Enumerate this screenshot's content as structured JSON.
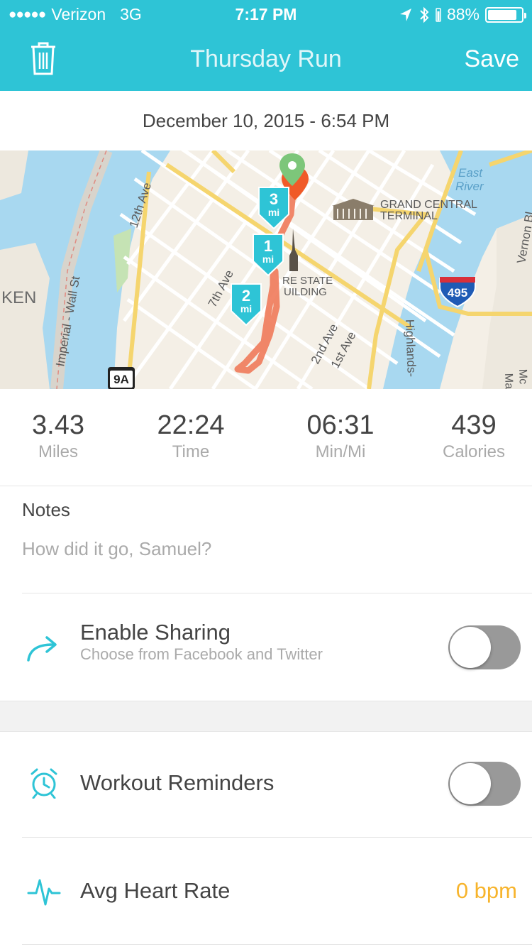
{
  "status_bar": {
    "signal_dots": "●●●●●",
    "carrier": "Verizon",
    "network": "3G",
    "time": "7:17 PM",
    "battery_text": "88%",
    "battery_level": 0.88
  },
  "nav": {
    "title": "Thursday Run",
    "save_label": "Save",
    "delete_icon": "trash-icon"
  },
  "run_datetime": "December 10, 2015 - 6:54 PM",
  "map": {
    "labels": {
      "east_river": "East\nRiver",
      "grand_central": "GRAND CENTRAL\nTERMINAL",
      "empire_state": "RE STATE\nUILDING",
      "twelfth_ave": "12th Ave",
      "seventh_ave": "7th Ave",
      "second_ave": "2nd Ave",
      "first_ave": "1st Ave",
      "imperial_wall": "Imperial - Wall St",
      "highlands": "Highlands-",
      "vernon": "Vernon Bl",
      "ken": "KEN",
      "mc": "Mc",
      "ma": "Ma"
    },
    "shields": {
      "interstate": "495",
      "route": "9A"
    },
    "mile_markers": [
      {
        "num": "3",
        "unit": "mi"
      },
      {
        "num": "1",
        "unit": "mi"
      },
      {
        "num": "2",
        "unit": "mi"
      }
    ],
    "colors": {
      "route": "#f07a5a",
      "marker": "#2ec4d6",
      "start_pin": "#7dc67a",
      "end_pin": "#f05a28",
      "water": "#a8d8f0"
    }
  },
  "stats": [
    {
      "value": "3.43",
      "label": "Miles"
    },
    {
      "value": "22:24",
      "label": "Time"
    },
    {
      "value": "06:31",
      "label": "Min/Mi"
    },
    {
      "value": "439",
      "label": "Calories"
    }
  ],
  "notes": {
    "title": "Notes",
    "placeholder": "How did it go, Samuel?"
  },
  "sharing": {
    "icon": "share-arrow-icon",
    "title": "Enable Sharing",
    "subtitle": "Choose from Facebook and Twitter",
    "enabled": false
  },
  "reminders": {
    "icon": "alarm-clock-icon",
    "title": "Workout Reminders",
    "enabled": false
  },
  "heart_rate": {
    "icon": "heartbeat-icon",
    "title": "Avg Heart Rate",
    "value": "0 bpm"
  },
  "colors": {
    "accent": "#2ec4d6",
    "heart_rate_value": "#f7b42c"
  }
}
